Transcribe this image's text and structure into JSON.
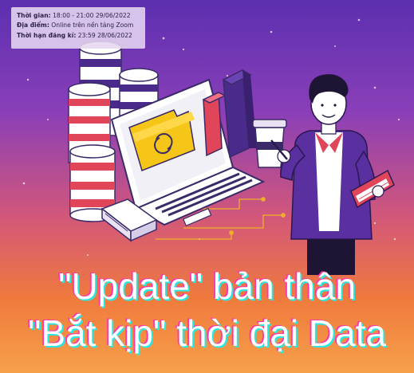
{
  "info": {
    "time_label": "Thời gian:",
    "time_value": "18:00 - 21:00 29/06/2022",
    "place_label": "Địa điểm:",
    "place_value": "Online trên nền tảng Zoom",
    "deadline_label": "Thời hạn đăng kí:",
    "deadline_value": "23:59 28/06/2022"
  },
  "headline": {
    "line1": "\"Update\" bản thân",
    "line2": "\"Bắt kịp\" thời đại Data"
  },
  "colors": {
    "bg_top": "#5b2fb0",
    "bg_bottom": "#f6a04a",
    "accent_red": "#e0455a",
    "accent_purple": "#4a2a8a",
    "folder_yellow": "#f5c518",
    "text_shadow_cyan": "#2de6e0",
    "text_shadow_pink": "#ff3aa8"
  },
  "icons": [
    "database-stack-icon",
    "laptop-icon",
    "folder-sync-icon",
    "bar-chart-icon",
    "coffee-cup-icon",
    "server-icon",
    "presenter-illustration",
    "book-icon"
  ]
}
